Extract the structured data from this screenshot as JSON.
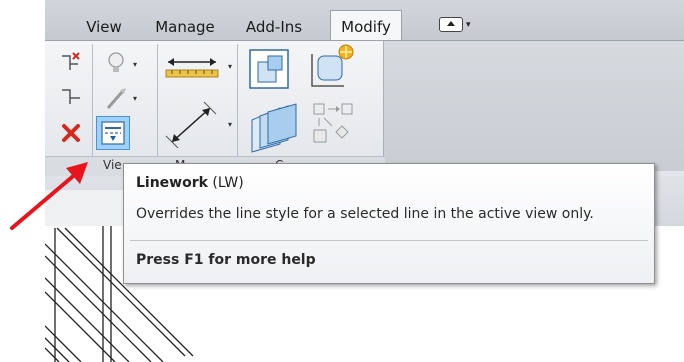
{
  "ribbon": {
    "tabs": [
      {
        "label": "View",
        "active": false
      },
      {
        "label": "Manage",
        "active": false
      },
      {
        "label": "Add-Ins",
        "active": false
      },
      {
        "label": "Modify",
        "active": true
      }
    ],
    "panels": {
      "view_panel_title": "Vie",
      "measure_panel_title": "M",
      "create_panel_title": "C"
    }
  },
  "tooltip": {
    "title": "Linework",
    "shortcut": "(LW)",
    "description": "Overrides the line style for a selected line in the active view only.",
    "help": "Press F1 for more help"
  },
  "colors": {
    "annotation_arrow": "#e8141c",
    "active_tool_highlight": "#9fd0f5",
    "delete_icon": "#d22a1e"
  },
  "icons": [
    "linework-icon",
    "override-graphics-icon",
    "hide-element-icon",
    "unhide-icon",
    "remove-icon",
    "paint-icon",
    "aligned-dimension-icon",
    "measure-icon",
    "create-assembly-icon",
    "create-group-icon",
    "create-parts-icon",
    "similar-icon",
    "quick-access-dropdown-icon"
  ]
}
